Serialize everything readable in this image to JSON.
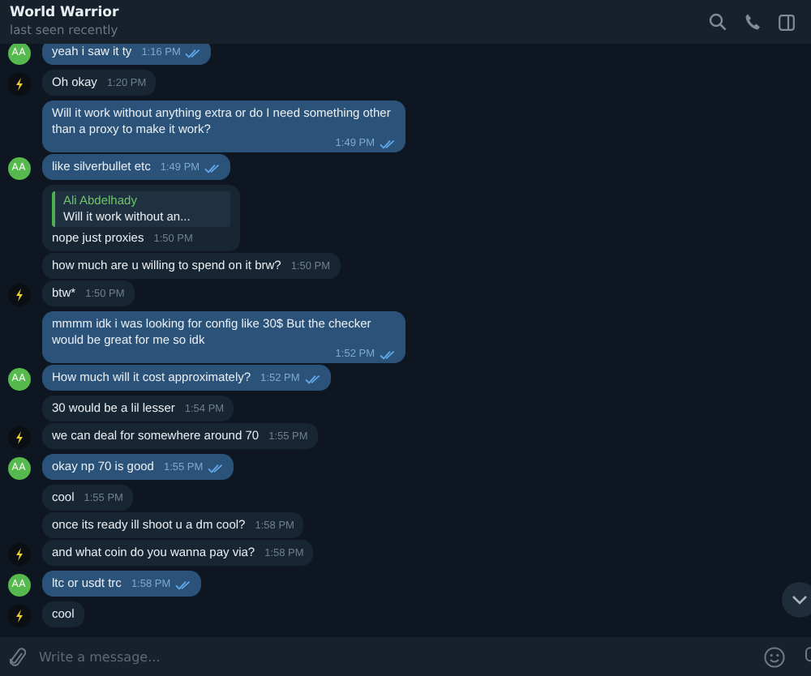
{
  "header": {
    "title": "World Warrior",
    "status": "last seen recently"
  },
  "messages": [
    {
      "kind": "out",
      "text": "yeah i saw it ty",
      "time": "1:16 PM",
      "read": true,
      "avatar": true,
      "avatar_text": "AA"
    },
    {
      "kind": "in",
      "text": "Oh okay",
      "time": "1:20 PM",
      "avatar": true
    },
    {
      "kind": "out",
      "text": "Will it work without anything extra or do I need something other than a proxy to make it work?",
      "time": "1:49 PM",
      "read": true,
      "avatar": false
    },
    {
      "kind": "out",
      "text": "like silverbullet etc",
      "time": "1:49 PM",
      "read": true,
      "avatar": true,
      "avatar_text": "AA"
    },
    {
      "kind": "in",
      "reply": {
        "name": "Ali Abdelhady",
        "text": "Will it work without an..."
      },
      "text": "nope just proxies",
      "time": "1:50 PM",
      "avatar": false
    },
    {
      "kind": "in",
      "text": "how much are u willing to spend on it brw?",
      "time": "1:50 PM",
      "avatar": false
    },
    {
      "kind": "in",
      "text": "btw*",
      "time": "1:50 PM",
      "avatar": true
    },
    {
      "kind": "out",
      "text": "mmmm idk i was looking for config like 30$  But the checker would be great for me so idk",
      "time": "1:52 PM",
      "read": true,
      "avatar": false
    },
    {
      "kind": "out",
      "text": "How much will it cost approximately?",
      "time": "1:52 PM",
      "read": true,
      "avatar": true,
      "avatar_text": "AA"
    },
    {
      "kind": "in",
      "text": "30 would be a lil lesser",
      "time": "1:54 PM",
      "avatar": false
    },
    {
      "kind": "in",
      "text": "we can deal for somewhere around 70",
      "time": "1:55 PM",
      "avatar": true
    },
    {
      "kind": "out",
      "text": "okay np 70 is good",
      "time": "1:55 PM",
      "read": true,
      "avatar": true,
      "avatar_text": "AA"
    },
    {
      "kind": "in",
      "text": "cool",
      "time": "1:55 PM",
      "avatar": false
    },
    {
      "kind": "in",
      "text": "once its ready ill shoot u a dm cool?",
      "time": "1:58 PM",
      "avatar": false
    },
    {
      "kind": "in",
      "text": "and what coin do you wanna pay via?",
      "time": "1:58 PM",
      "avatar": true
    },
    {
      "kind": "out",
      "text": "ltc or usdt trc",
      "time": "1:58 PM",
      "read": true,
      "avatar": true,
      "avatar_text": "AA"
    },
    {
      "kind": "in",
      "text": "cool",
      "avatar": true
    }
  ],
  "composer": {
    "placeholder": "Write a message..."
  }
}
